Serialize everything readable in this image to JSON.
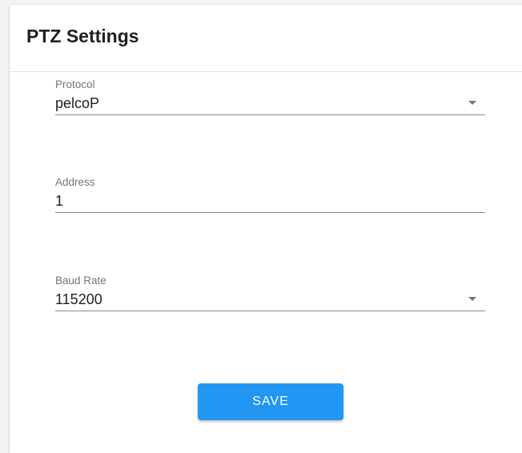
{
  "card": {
    "title": "PTZ Settings"
  },
  "form": {
    "protocol": {
      "label": "Protocol",
      "value": "pelcoP"
    },
    "address": {
      "label": "Address",
      "value": "1"
    },
    "baud_rate": {
      "label": "Baud Rate",
      "value": "115200"
    },
    "save_label": "SAVE"
  },
  "icons": {
    "select_caret": "caret-down-icon"
  },
  "colors": {
    "accent": "#2196f3",
    "text": "#212121",
    "label": "#757575",
    "divider": "#e2e2e2",
    "underline": "#8a8a8a"
  }
}
